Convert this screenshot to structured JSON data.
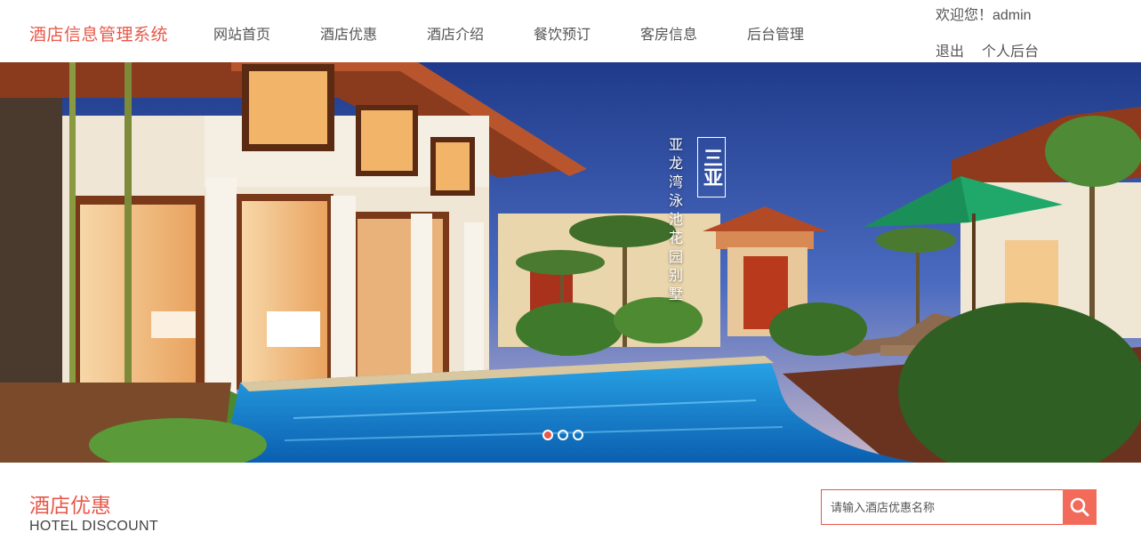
{
  "header": {
    "brand": "酒店信息管理系统",
    "nav": [
      {
        "label": "网站首页"
      },
      {
        "label": "酒店优惠"
      },
      {
        "label": "酒店介绍"
      },
      {
        "label": "餐饮预订"
      },
      {
        "label": "客房信息"
      },
      {
        "label": "后台管理"
      }
    ],
    "welcome": "欢迎您！admin",
    "logout": "退出",
    "personal": "个人后台"
  },
  "banner": {
    "caption": "亚龙湾泳池花园别墅",
    "seal": "三亚",
    "slide_count": 3,
    "active_slide": 1
  },
  "section": {
    "title": "酒店优惠",
    "subtitle": "HOTEL DISCOUNT",
    "search_placeholder": "请输入酒店优惠名称"
  },
  "colors": {
    "accent": "#e8584a",
    "search_button": "#f26a5a"
  },
  "icons": [
    "search-icon"
  ]
}
